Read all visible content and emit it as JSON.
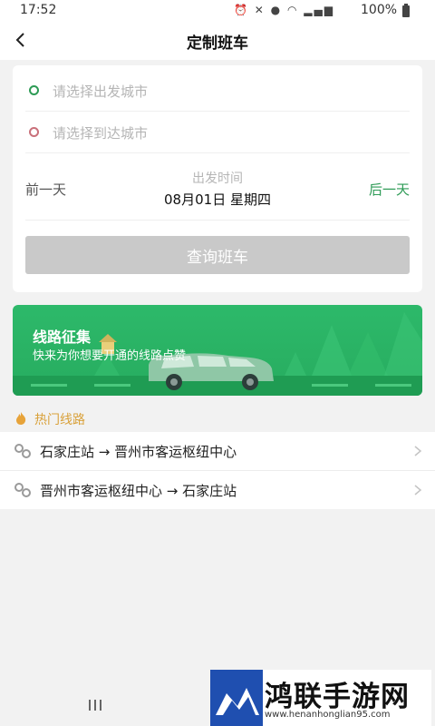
{
  "status_bar": {
    "time": "17:52",
    "icons": [
      "alarm-icon",
      "mute-icon",
      "location-icon",
      "wifi-icon",
      "signal-icon"
    ],
    "battery": "100%"
  },
  "nav": {
    "title": "定制班车"
  },
  "search_card": {
    "from_placeholder": "请选择出发城市",
    "to_placeholder": "请选择到达城市",
    "prev_day": "前一天",
    "next_day": "后一天",
    "date_caption": "出发时间",
    "date_value": "08月01日 星期四",
    "query_button": "查询班车"
  },
  "banner": {
    "title": "线路征集",
    "subtitle": "快来为你想要开通的线路点赞"
  },
  "hot_routes": {
    "title": "热门线路",
    "items": [
      {
        "text": "石家庄站 → 晋州市客运枢纽中心"
      },
      {
        "text": "晋州市客运枢纽中心 → 石家庄站"
      }
    ]
  },
  "watermark": {
    "title": "鸿联手游网",
    "url": "www.henanhonglian95.com"
  },
  "colors": {
    "accent_green": "#2e9b56",
    "banner_green": "#2db96a",
    "hot_orange": "#d9a13a",
    "disabled_button": "#c9c9c9"
  }
}
